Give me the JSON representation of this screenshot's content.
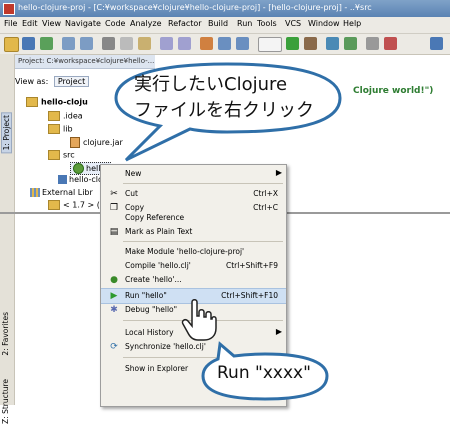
{
  "window": {
    "title": "hello-clojure-proj - [C:¥workspace¥clojure¥hello-clojure-proj] - [hello-clojure-proj] - ..¥src"
  },
  "menubar": [
    "File",
    "Edit",
    "View",
    "Navigate",
    "Code",
    "Analyze",
    "Refactor",
    "Build",
    "Run",
    "Tools",
    "VCS",
    "Window",
    "Help"
  ],
  "sidebar": {
    "project_tab": "1: Project",
    "favorites_tab": "2: Favorites",
    "structure_tab": "Z: Structure"
  },
  "project_panel": {
    "header": "Project: C:¥workspace¥clojure¥hello-...",
    "view_as_label": "View as:",
    "view_as_value": "Project",
    "tree": [
      "hello-cloju",
      ".idea",
      "lib",
      "clojure.jar",
      "src",
      "hello.",
      "hello-clo",
      "External Libr",
      "< 1.7 > (C"
    ]
  },
  "editor": {
    "text": "Clojure world!\")"
  },
  "context_menu": {
    "new": "New",
    "cut": "Cut",
    "cut_sc": "Ctrl+X",
    "copy": "Copy",
    "copy_sc": "Ctrl+C",
    "copy_ref": "Copy Reference",
    "mark_plain": "Mark as Plain Text",
    "make_module": "Make Module 'hello-clojure-proj'",
    "compile": "Compile 'hello.clj'",
    "compile_sc": "Ctrl+Shift+F9",
    "create": "Create 'hello'...",
    "run": "Run \"hello\"",
    "run_sc": "Ctrl+Shift+F10",
    "debug": "Debug \"hello\"",
    "local_history": "Local History",
    "synchronize": "Synchronize 'hello.clj'",
    "show_explorer": "Show in Explorer"
  },
  "callouts": {
    "top_line1": "実行したいClojure",
    "top_line2": "ファイルを右クリック",
    "bottom": "Run \"xxxx\""
  },
  "colors": {
    "highlight": "#cfe0f3",
    "callout_border": "#2f6fa8",
    "editor_text": "#2e7d32"
  }
}
